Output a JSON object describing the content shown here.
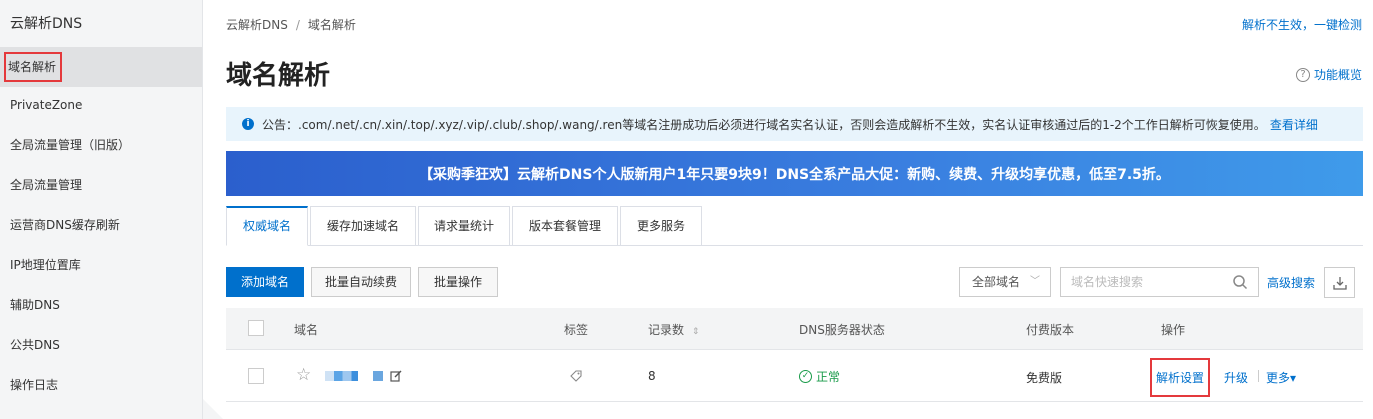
{
  "sidebar": {
    "title": "云解析DNS",
    "items": [
      {
        "label": "域名解析",
        "active": true
      },
      {
        "label": "PrivateZone"
      },
      {
        "label": "全局流量管理（旧版）"
      },
      {
        "label": "全局流量管理"
      },
      {
        "label": "运营商DNS缓存刷新"
      },
      {
        "label": "IP地理位置库"
      },
      {
        "label": "辅助DNS"
      },
      {
        "label": "公共DNS"
      },
      {
        "label": "操作日志"
      }
    ]
  },
  "header": {
    "breadcrumb": [
      "云解析DNS",
      "域名解析"
    ],
    "breadcrumb_sep": "/",
    "top_link": "解析不生效，一键检测",
    "title": "域名解析",
    "help_link": "功能概览"
  },
  "notice": {
    "text": "公告：.com/.net/.cn/.xin/.top/.xyz/.vip/.club/.shop/.wang/.ren等域名注册成功后必须进行域名实名认证，否则会造成解析不生效，实名认证审核通过后的1-2个工作日解析可恢复使用。",
    "link": "查看详细"
  },
  "banner": {
    "text": "【采购季狂欢】云解析DNS个人版新用户1年只要9块9！DNS全系产品大促：新购、续费、升级均享优惠，低至7.5折。"
  },
  "tabs": [
    {
      "label": "权威域名",
      "active": true
    },
    {
      "label": "缓存加速域名"
    },
    {
      "label": "请求量统计"
    },
    {
      "label": "版本套餐管理"
    },
    {
      "label": "更多服务"
    }
  ],
  "toolbar": {
    "add_domain": "添加域名",
    "batch_renew": "批量自动续费",
    "batch_ops": "批量操作",
    "filter_select": "全部域名",
    "search_placeholder": "域名快速搜索",
    "advanced_search": "高级搜索"
  },
  "table": {
    "columns": [
      "域名",
      "标签",
      "记录数",
      "DNS服务器状态",
      "付费版本",
      "操作"
    ],
    "rows": [
      {
        "records": "8",
        "dns_status": "正常",
        "plan": "免费版",
        "actions": {
          "settings": "解析设置",
          "upgrade": "升级",
          "more": "更多▾"
        }
      }
    ]
  },
  "colors": {
    "accent": "#0070cc",
    "ok": "#1a9b4a",
    "highlight": "#e4393c"
  }
}
